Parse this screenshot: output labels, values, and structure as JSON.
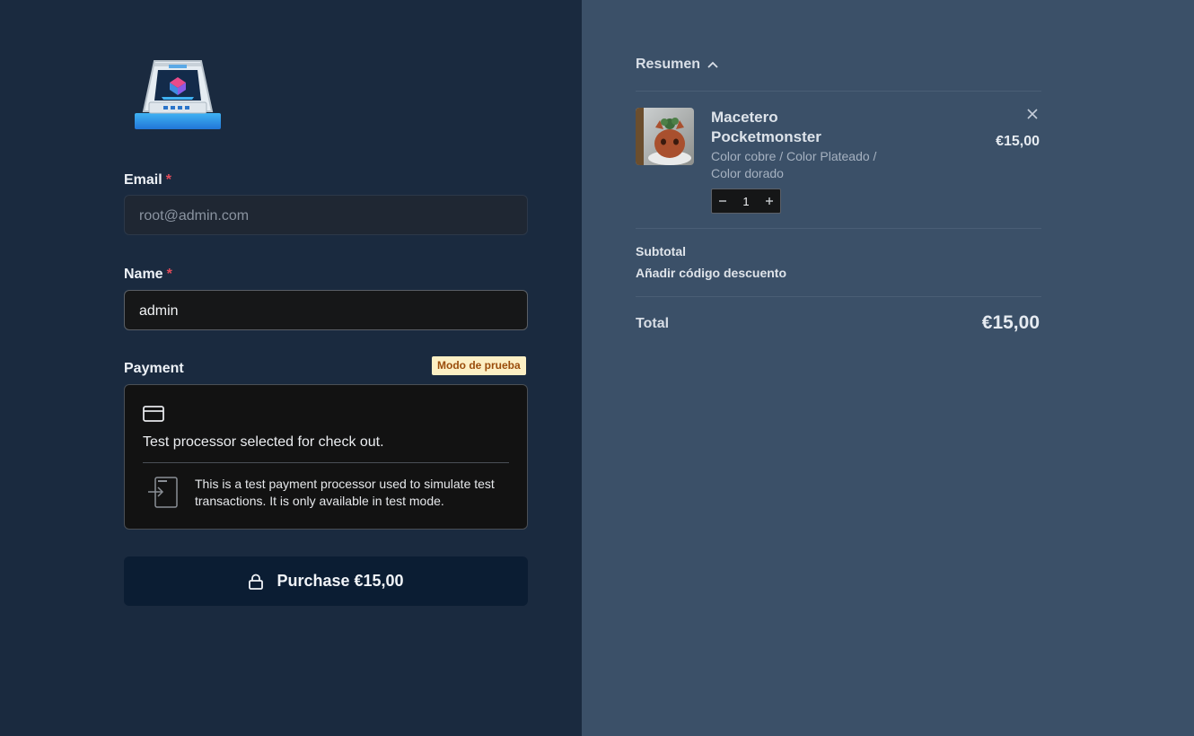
{
  "brand": {
    "logo": "printer-3d-logo-icon"
  },
  "form": {
    "email_label": "Email",
    "email_value": "root@admin.com",
    "name_label": "Name",
    "name_value": "admin",
    "required_mark": "*",
    "payment_label": "Payment",
    "test_mode_badge": "Modo de prueba",
    "processor_title": "Test processor selected for check out.",
    "processor_description": "This is a test payment processor used to simulate test transactions. It is only available in test mode.",
    "purchase_label": "Purchase €15,00"
  },
  "summary": {
    "toggle_label": "Resumen",
    "item": {
      "name": "Macetero Pocketmonster",
      "variant": "Color cobre / Color Plateado / Color dorado",
      "price": "€15,00",
      "quantity": "1"
    },
    "subtotal_label": "Subtotal",
    "discount_link": "Añadir código descuento",
    "total_label": "Total",
    "total_value": "€15,00"
  },
  "colors": {
    "left_background": "#1a2a3f",
    "right_background": "#3b5068",
    "button_background": "#0b1d33",
    "required": "#e24b5a",
    "badge_background": "#fcefc4",
    "badge_text": "#9a4d0b"
  }
}
